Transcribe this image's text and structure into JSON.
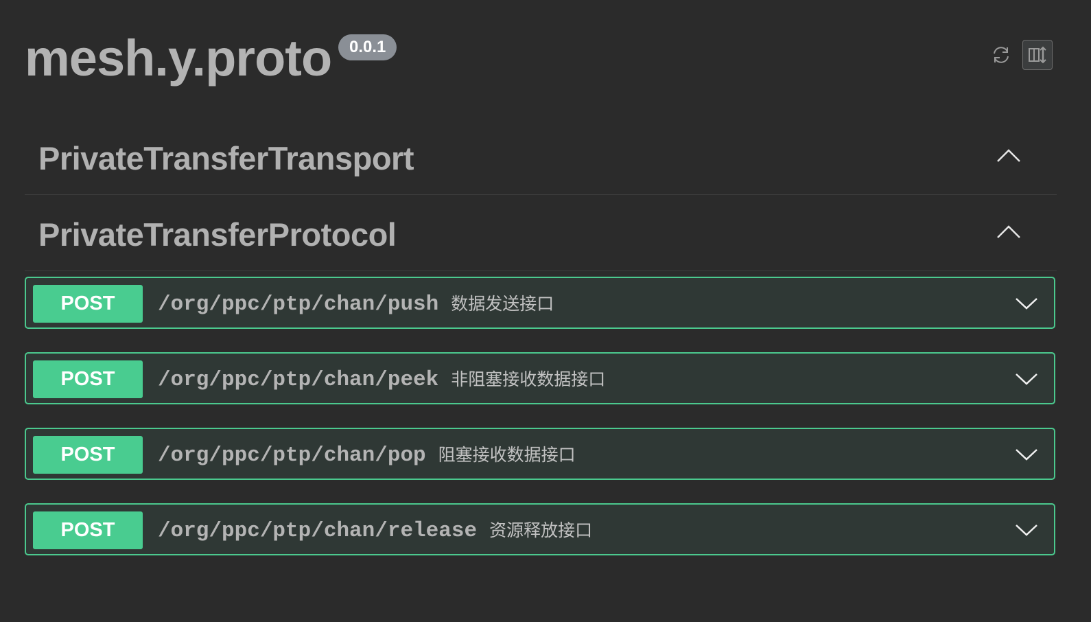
{
  "header": {
    "title": "mesh.y.proto",
    "version": "0.0.1",
    "icons": {
      "refresh": "refresh-icon",
      "layout": "layout-toggle-icon"
    }
  },
  "tags": [
    {
      "name": "PrivateTransferTransport",
      "expanded": true
    },
    {
      "name": "PrivateTransferProtocol",
      "expanded": true
    }
  ],
  "operations": [
    {
      "method": "POST",
      "path": "/org/ppc/ptp/chan/push",
      "summary": "数据发送接口"
    },
    {
      "method": "POST",
      "path": "/org/ppc/ptp/chan/peek",
      "summary": "非阻塞接收数据接口"
    },
    {
      "method": "POST",
      "path": "/org/ppc/ptp/chan/pop",
      "summary": "阻塞接收数据接口"
    },
    {
      "method": "POST",
      "path": "/org/ppc/ptp/chan/release",
      "summary": "资源释放接口"
    }
  ],
  "colors": {
    "background": "#2b2b2b",
    "post": "#49cc90",
    "post_border": "#4bc98e",
    "post_bg": "#2f3835"
  }
}
